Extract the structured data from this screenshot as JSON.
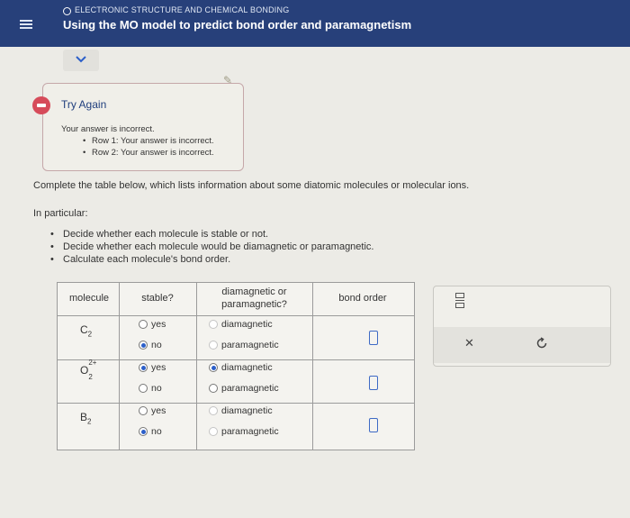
{
  "header": {
    "topic": "ELECTRONIC STRUCTURE AND CHEMICAL BONDING",
    "title": "Using the MO model to predict bond order and paramagnetism"
  },
  "feedback": {
    "title": "Try Again",
    "message": "Your answer is incorrect.",
    "items": [
      "Row 1: Your answer is incorrect.",
      "Row 2: Your answer is incorrect."
    ]
  },
  "instructions": {
    "intro": "Complete the table below, which lists information about some diatomic molecules or molecular ions.",
    "particular": "In particular:",
    "bullets": [
      "Decide whether each molecule is stable or not.",
      "Decide whether each molecule would be diamagnetic or paramagnetic.",
      "Calculate each molecule's bond order."
    ]
  },
  "table": {
    "headers": {
      "molecule": "molecule",
      "stable": "stable?",
      "magnetic_line1": "diamagnetic or",
      "magnetic_line2": "paramagnetic?",
      "bond_order": "bond order"
    },
    "rows": [
      {
        "base": "C",
        "sub": "2",
        "sup": "",
        "stable_selected": "no",
        "magnetic_selected": "",
        "bond_order": ""
      },
      {
        "base": "O",
        "sub": "2",
        "sup": "2+",
        "stable_selected": "yes",
        "magnetic_selected": "diamagnetic",
        "bond_order": ""
      },
      {
        "base": "B",
        "sub": "2",
        "sup": "",
        "stable_selected": "no",
        "magnetic_selected": "",
        "bond_order": ""
      }
    ],
    "option_yes": "yes",
    "option_no": "no",
    "option_dia": "diamagnetic",
    "option_para": "paramagnetic"
  },
  "tools": {
    "icons": [
      "fraction-icon",
      "close-icon",
      "undo-icon"
    ]
  },
  "colors": {
    "header_bg": "#27407a",
    "accent_blue": "#2c5fc9",
    "error_red": "#d64b5a"
  }
}
